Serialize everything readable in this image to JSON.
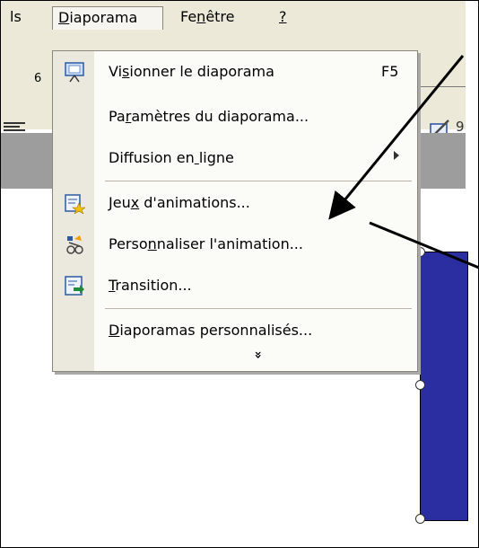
{
  "menubar": {
    "items": [
      {
        "label": "ls",
        "mnemonic_index": -1
      },
      {
        "label": "Diaporama",
        "mnemonic_index": 0
      },
      {
        "label": "Fenêtre",
        "mnemonic_index": 2
      },
      {
        "label": "?",
        "mnemonic_index": 0
      }
    ]
  },
  "toolbar": {
    "font_size": "6",
    "right_letter": "9"
  },
  "menu": {
    "items": [
      {
        "label": "Visionner le diaporama",
        "mnemonic_index": 2,
        "shortcut": "F5",
        "icon": "slideshow-screen-icon"
      },
      {
        "label": "Paramètres du diaporama...",
        "mnemonic_index": 2,
        "shortcut": "",
        "icon": ""
      },
      {
        "label": "Diffusion en ligne",
        "mnemonic_index": 12,
        "shortcut": "",
        "icon": "",
        "submenu": true
      },
      {
        "label": "Jeux d'animations...",
        "mnemonic_index": 3,
        "shortcut": "",
        "icon": "animation-schemes-icon"
      },
      {
        "label": "Personnaliser l'animation...",
        "mnemonic_index": 5,
        "shortcut": "",
        "icon": "custom-animation-icon"
      },
      {
        "label": "Transition...",
        "mnemonic_index": 0,
        "shortcut": "",
        "icon": "transition-icon"
      },
      {
        "label": "Diaporamas personnalisés...",
        "mnemonic_index": 0,
        "shortcut": "",
        "icon": ""
      }
    ],
    "expand_glyph": "»"
  },
  "colors": {
    "menubar_bg": "#ece9d8",
    "menu_bg": "#fbfbf8",
    "slide_shape": "#2a2ea0",
    "band": "#9d9d9d"
  }
}
